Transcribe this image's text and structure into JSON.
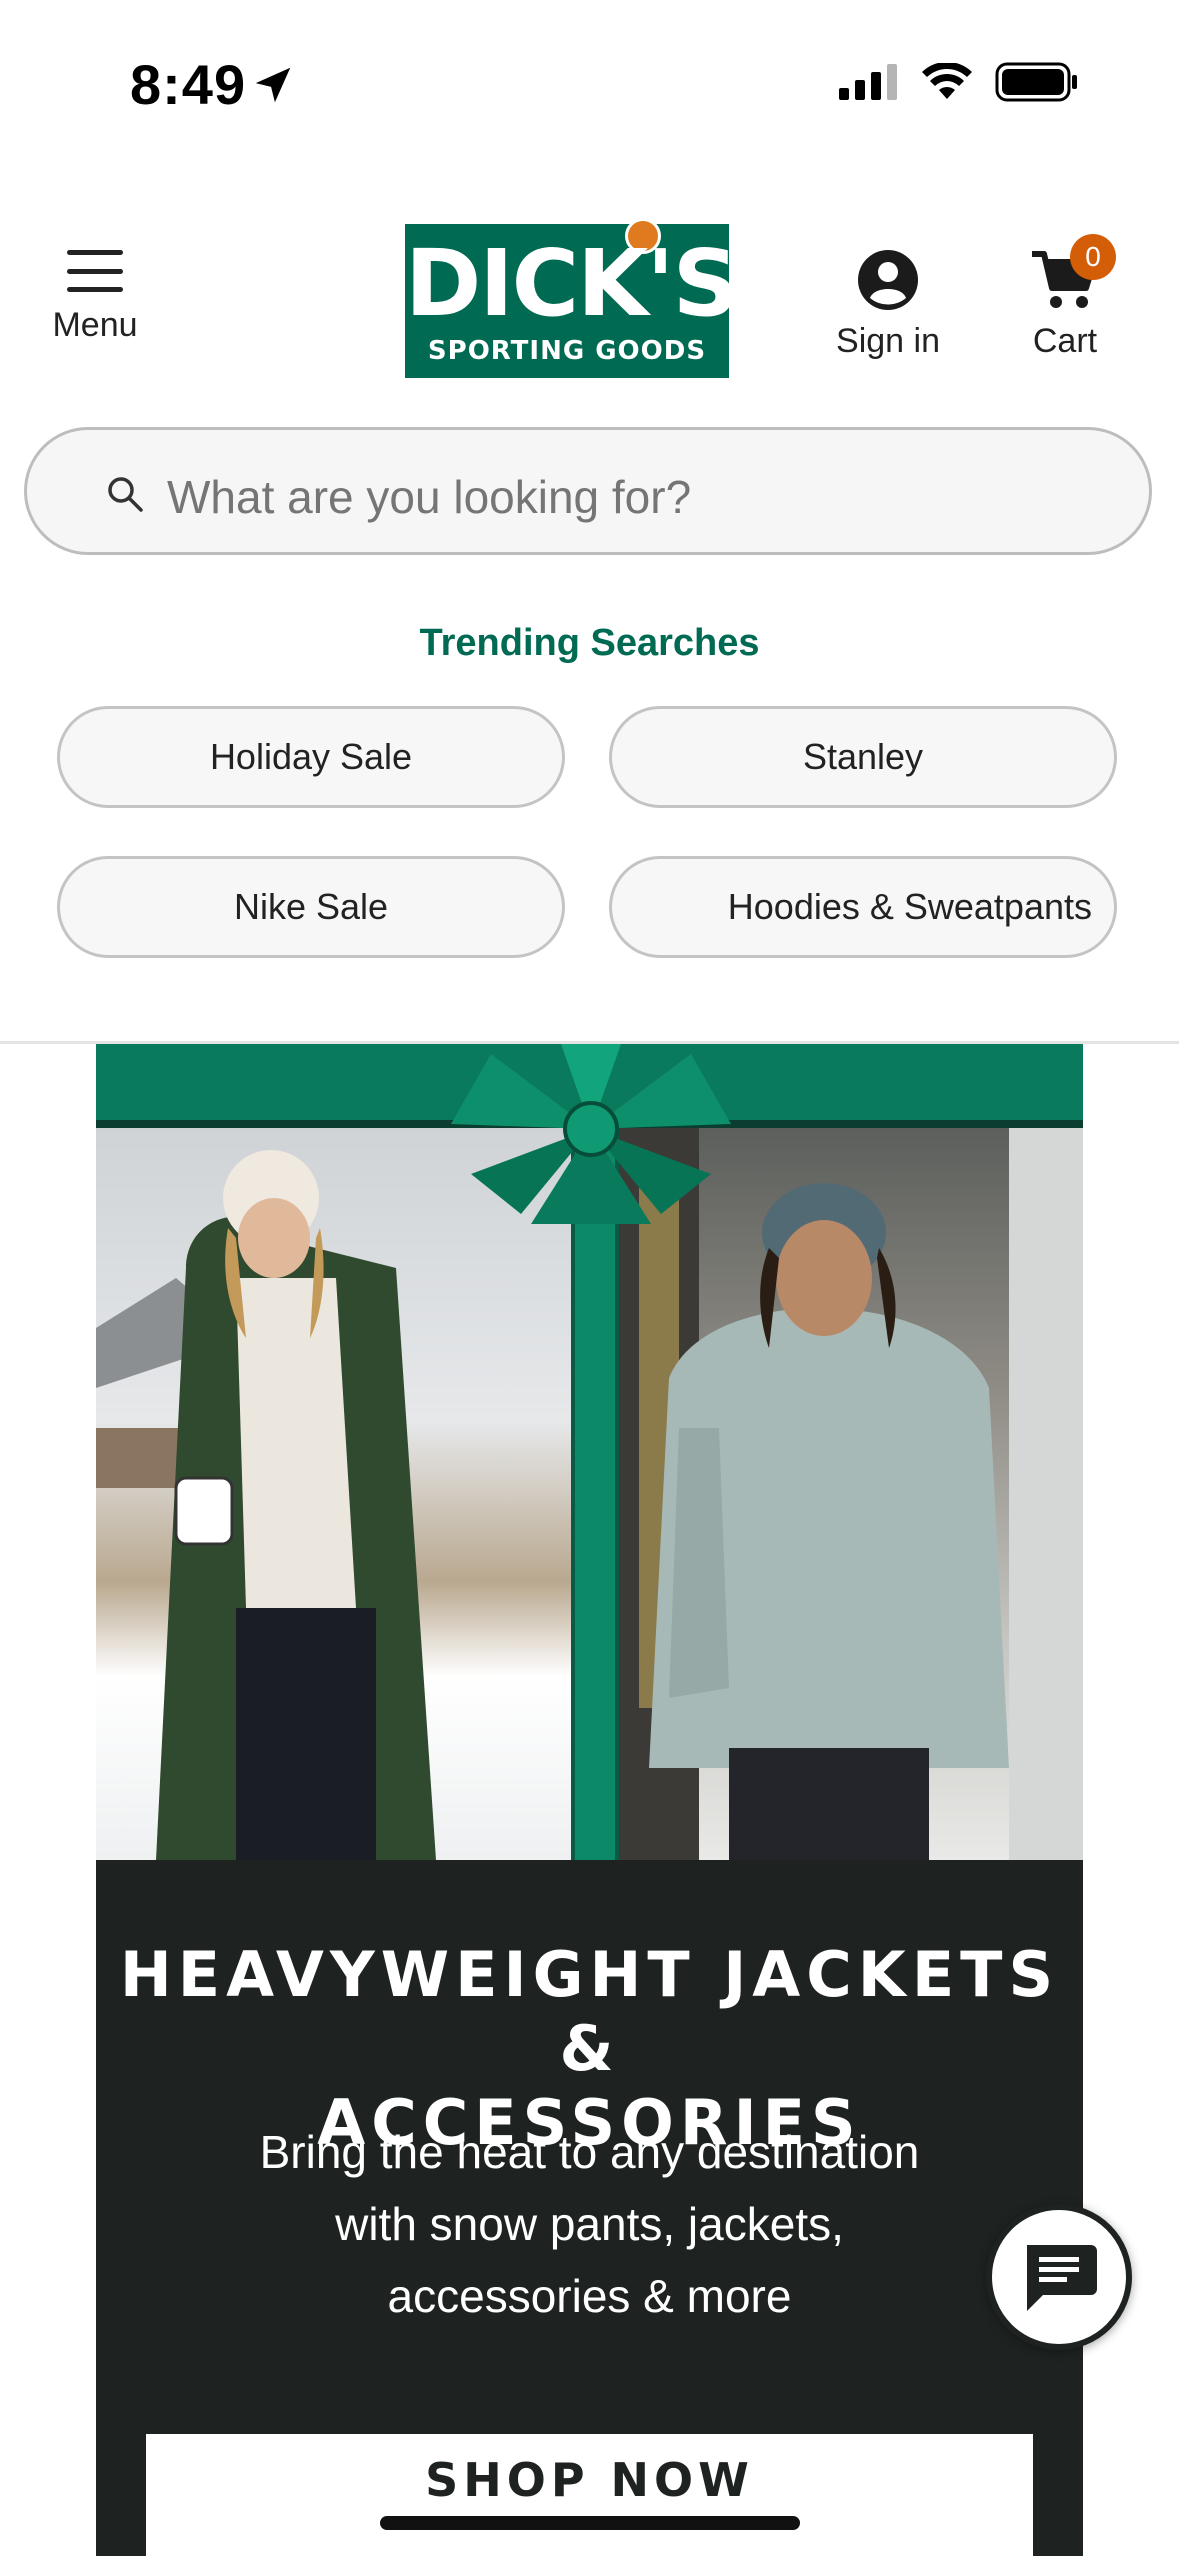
{
  "status_bar": {
    "time": "8:49"
  },
  "header": {
    "menu_label": "Menu",
    "logo_main": "DICK'S",
    "logo_sub": "SPORTING GOODS",
    "signin_label": "Sign in",
    "cart_label": "Cart",
    "cart_count": "0"
  },
  "search": {
    "placeholder": "What are you looking for?"
  },
  "trending": {
    "title": "Trending Searches",
    "items": [
      "Holiday Sale",
      "Stanley",
      "Nike Sale",
      "Hoodies & Sweatpants"
    ]
  },
  "banner": {
    "headline_1": "HEAVYWEIGHT JACKETS &",
    "headline_2": "ACCESSORIES",
    "sub_1": "Bring the heat to any destination",
    "sub_2": "with snow pants, jackets,",
    "sub_3": "accessories & more",
    "cta": "SHOP NOW"
  },
  "colors": {
    "brand_green": "#006b52",
    "cart_badge": "#d45d08",
    "banner_bg": "#1e2322"
  }
}
